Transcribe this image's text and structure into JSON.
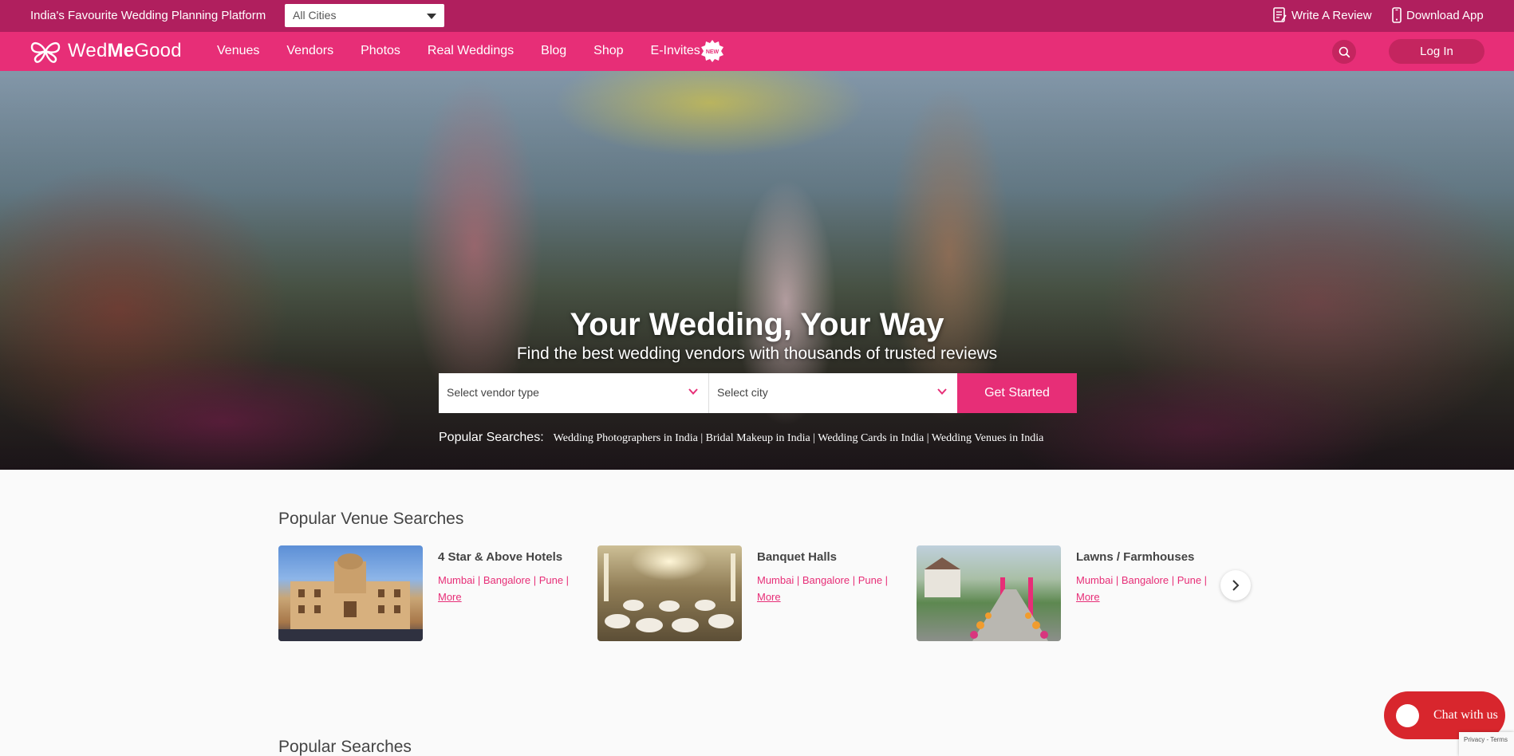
{
  "topstrip": {
    "tagline": "India's Favourite Wedding Planning Platform",
    "city_select": "All Cities",
    "write_review": "Write A Review",
    "download_app": "Download App"
  },
  "navbar": {
    "logo_prefix": "Wed",
    "logo_bold": "Me",
    "logo_suffix": "Good",
    "items": [
      "Venues",
      "Vendors",
      "Photos",
      "Real Weddings",
      "Blog",
      "Shop",
      "E-Invites"
    ],
    "new_badge": "NEW",
    "login": "Log In"
  },
  "hero": {
    "title": "Your Wedding, Your Way",
    "subtitle": "Find the best wedding vendors with thousands of trusted reviews",
    "vendor_placeholder": "Select vendor type",
    "city_placeholder": "Select city",
    "cta": "Get Started",
    "popular_label": "Popular Searches:",
    "popular_links": "Wedding Photographers in India | Bridal Makeup in India | Wedding Cards in India | Wedding Venues in India"
  },
  "venues": {
    "title": "Popular Venue Searches",
    "cards": [
      {
        "name": "4 Star & Above Hotels",
        "cities": "Mumbai | Bangalore | Pune |",
        "more": "More"
      },
      {
        "name": "Banquet Halls",
        "cities": "Mumbai | Bangalore | Pune |",
        "more": "More"
      },
      {
        "name": "Lawns / Farmhouses",
        "cities": "Mumbai | Bangalore | Pune |",
        "more": "More"
      }
    ]
  },
  "popular_searches_title": "Popular Searches",
  "chat": {
    "label": "Chat with us"
  },
  "recaptcha": {
    "text": "Privacy - Terms"
  },
  "colors": {
    "brand": "#e72e77",
    "brand_dark": "#b01f5e",
    "chat": "#d8262d"
  }
}
